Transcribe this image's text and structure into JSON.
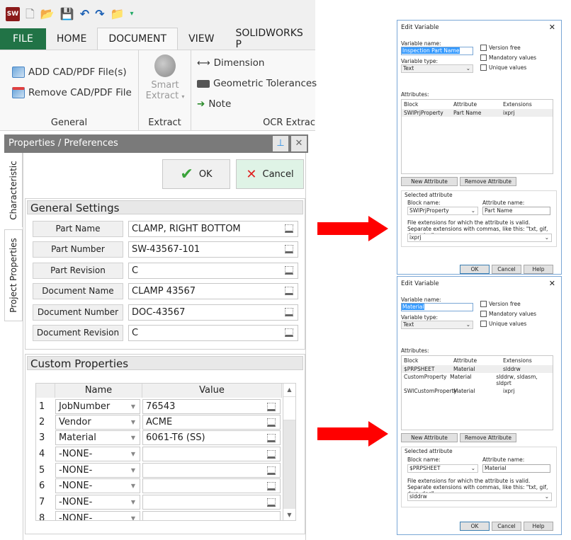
{
  "app": {
    "quick_access": [
      {
        "icon": "app-logo-icon",
        "glyph": "SW"
      },
      {
        "icon": "new-file-icon",
        "glyph": "🗋"
      },
      {
        "icon": "open-folder-icon",
        "glyph": "📂"
      },
      {
        "icon": "save-icon",
        "glyph": "💾"
      },
      {
        "icon": "undo-icon",
        "glyph": "↶"
      },
      {
        "icon": "redo-icon",
        "glyph": "↷"
      },
      {
        "icon": "open-recent-icon",
        "glyph": "📁"
      },
      {
        "icon": "customize-qat-icon",
        "glyph": "▾"
      }
    ],
    "tabs": [
      "FILE",
      "HOME",
      "DOCUMENT",
      "VIEW",
      "SOLIDWORKS P"
    ],
    "active_tab": "DOCUMENT",
    "ribbon": {
      "general": {
        "label": "General",
        "add": "ADD CAD/PDF File(s)",
        "remove": "Remove CAD/PDF File"
      },
      "extract": {
        "label": "Extract",
        "smart_line1": "Smart",
        "smart_line2": "Extract"
      },
      "ocr": {
        "label": "OCR Extrac",
        "dimension": "Dimension",
        "gdt": "Geometric Tolerances",
        "note": "Note"
      }
    }
  },
  "panel": {
    "title": "Properties / Preferences",
    "vertical_tabs": [
      "Characteristic",
      "Project Properties"
    ],
    "ok_label": "OK",
    "cancel_label": "Cancel",
    "general_settings": {
      "title": "General Settings",
      "fields": [
        {
          "label": "Part Name",
          "value": "CLAMP, RIGHT BOTTOM"
        },
        {
          "label": "Part Number",
          "value": "SW-43567-101"
        },
        {
          "label": "Part Revision",
          "value": "C"
        },
        {
          "label": "Document Name",
          "value": "CLAMP 43567"
        },
        {
          "label": "Document Number",
          "value": "DOC-43567"
        },
        {
          "label": "Document Revision",
          "value": "C"
        }
      ]
    },
    "custom_properties": {
      "title": "Custom Properties",
      "columns": [
        "Name",
        "Value"
      ],
      "rows": [
        {
          "n": "1",
          "name": "JobNumber",
          "value": "76543"
        },
        {
          "n": "2",
          "name": "Vendor",
          "value": "ACME"
        },
        {
          "n": "3",
          "name": "Material",
          "value": "6061-T6 (SS)"
        },
        {
          "n": "4",
          "name": "-NONE-",
          "value": ""
        },
        {
          "n": "5",
          "name": "-NONE-",
          "value": ""
        },
        {
          "n": "6",
          "name": "-NONE-",
          "value": ""
        },
        {
          "n": "7",
          "name": "-NONE-",
          "value": ""
        },
        {
          "n": "8",
          "name": "-NONE-",
          "value": ""
        }
      ]
    }
  },
  "dialogs": [
    {
      "title": "Edit Variable",
      "variable_name_label": "Variable name:",
      "variable_name": "Inspection Part Name",
      "variable_type_label": "Variable type:",
      "variable_type": "Text",
      "checkboxes": [
        "Version free",
        "Mandatory values",
        "Unique values"
      ],
      "attributes_label": "Attributes:",
      "columns": [
        "Block",
        "Attribute",
        "Extensions"
      ],
      "rows": [
        [
          "SWIPrjProperty",
          "Part Name",
          "ixprj"
        ]
      ],
      "new_attribute": "New Attribute",
      "remove_attribute": "Remove Attribute",
      "selected_attribute": "Selected attribute",
      "block_name_label": "Block name:",
      "block_name": "SWIPrjProperty",
      "attribute_name_label": "Attribute name:",
      "attribute_name": "Part Name",
      "extensions_help": "File extensions for which the attribute is valid. Separate extensions with commas, like this: \"txt, gif, dwg, doc\":",
      "extensions": "ixprj",
      "ok": "OK",
      "cancel": "Cancel",
      "help": "Help"
    },
    {
      "title": "Edit Variable",
      "variable_name_label": "Variable name:",
      "variable_name": "Material",
      "variable_type_label": "Variable type:",
      "variable_type": "Text",
      "checkboxes": [
        "Version free",
        "Mandatory values",
        "Unique values"
      ],
      "attributes_label": "Attributes:",
      "columns": [
        "Block",
        "Attribute",
        "Extensions"
      ],
      "rows": [
        [
          "$PRPSHEET",
          "Material",
          "slddrw"
        ],
        [
          "CustomProperty",
          "Material",
          "slddrw, sldasm, sldprt"
        ],
        [
          "SWICustomProperty",
          "Material",
          "ixprj"
        ]
      ],
      "new_attribute": "New Attribute",
      "remove_attribute": "Remove Attribute",
      "selected_attribute": "Selected attribute",
      "block_name_label": "Block name:",
      "block_name": "$PRPSHEET",
      "attribute_name_label": "Attribute name:",
      "attribute_name": "Material",
      "extensions_help": "File extensions for which the attribute is valid. Separate extensions with commas, like this: \"txt, gif, dwg, doc\":",
      "extensions": "slddrw",
      "ok": "OK",
      "cancel": "Cancel",
      "help": "Help"
    }
  ],
  "colors": {
    "file_tab": "#217346",
    "arrow": "#ff0000",
    "panel_title": "#7a7a7a",
    "cancel_bg": "#dff3e6",
    "selection": "#3399ff"
  }
}
